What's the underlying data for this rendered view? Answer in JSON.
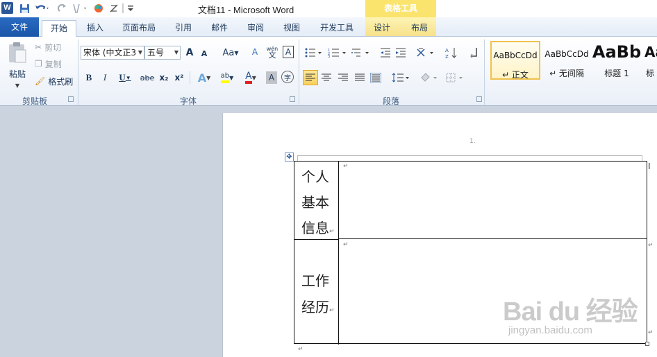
{
  "window": {
    "title": "文档11  -  Microsoft Word",
    "app_icon": "W"
  },
  "quick_access": {
    "icons": [
      "save-icon",
      "undo-icon",
      "redo-icon",
      "format-painter-icon",
      "color-icon",
      "clear-icon",
      "customize-icon"
    ]
  },
  "contextual_tabs": {
    "header": "表格工具",
    "tabs": [
      "设计",
      "布局"
    ]
  },
  "tabs": [
    "文件",
    "开始",
    "插入",
    "页面布局",
    "引用",
    "邮件",
    "审阅",
    "视图",
    "开发工具"
  ],
  "active_tab": "开始",
  "clipboard": {
    "paste_label": "粘贴",
    "cut_label": "剪切",
    "copy_label": "复制",
    "format_painter_label": "格式刷",
    "group_label": "剪贴板"
  },
  "font": {
    "font_name": "宋体 (中文正3",
    "font_size": "五号",
    "grow_label": "A",
    "shrink_label": "A",
    "case_label": "Aa",
    "clear_label": "A",
    "phonetic_label": "wén",
    "phonetic_top": "文",
    "border_label": "A",
    "bold": "B",
    "italic": "I",
    "underline": "U",
    "strike": "abe",
    "subscript": "x₂",
    "superscript": "x²",
    "effects": "A",
    "highlight": "ab",
    "font_color": "A",
    "char_shading": "A",
    "enclose": "字",
    "group_label": "字体"
  },
  "paragraph": {
    "group_label": "段落"
  },
  "styles": {
    "items": [
      {
        "sample": "AaBbCcDd",
        "name": "↵ 正文"
      },
      {
        "sample": "AaBbCcDd",
        "name": "↵ 无间隔"
      },
      {
        "sample": "AaBb",
        "name": "标题 1"
      },
      {
        "sample": "Aa",
        "name": "标"
      }
    ]
  },
  "document": {
    "page_marker": "1.",
    "table": {
      "rows": [
        {
          "label": [
            "个人",
            "基本",
            "信息"
          ],
          "content": ""
        },
        {
          "label": [
            "工作",
            "经历"
          ],
          "content": ""
        }
      ]
    },
    "paragraph_mark": "↵"
  },
  "watermark": {
    "logo": "Bai du 经验",
    "url": "jingyan.baidu.com"
  },
  "colors": {
    "file_tab": "#2a6bc2",
    "contextual_header": "#fbe46d",
    "style_selected_border": "#f0c24e",
    "doc_background": "#cbd4de",
    "highlight_yellow": "#ffff00",
    "font_color_red": "#e02020"
  }
}
